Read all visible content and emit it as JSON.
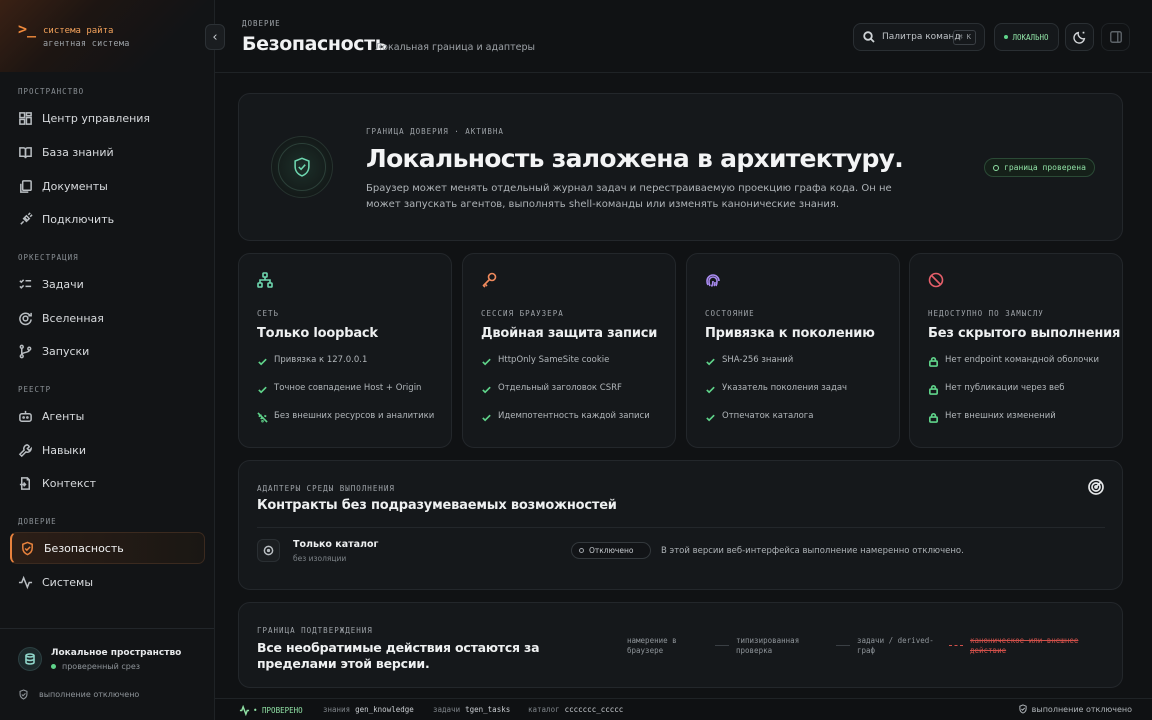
{
  "brand": {
    "prompt": ">_",
    "title": "система райта",
    "subtitle": "агентная система"
  },
  "sidebar": {
    "sections": [
      {
        "label": "ПРОСТРАНСТВО",
        "items": [
          {
            "label": "Центр управления",
            "icon": "dashboard-icon"
          },
          {
            "label": "База знаний",
            "icon": "book-icon"
          },
          {
            "label": "Документы",
            "icon": "documents-icon"
          },
          {
            "label": "Подключить",
            "icon": "plug-icon"
          }
        ]
      },
      {
        "label": "ОРКЕСТРАЦИЯ",
        "items": [
          {
            "label": "Задачи",
            "icon": "task-list-icon"
          },
          {
            "label": "Вселенная",
            "icon": "universe-icon"
          },
          {
            "label": "Запуски",
            "icon": "branch-icon"
          }
        ]
      },
      {
        "label": "РЕЕСТР",
        "items": [
          {
            "label": "Агенты",
            "icon": "bot-icon"
          },
          {
            "label": "Навыки",
            "icon": "wrench-icon"
          },
          {
            "label": "Контекст",
            "icon": "context-icon"
          }
        ]
      },
      {
        "label": "ДОВЕРИЕ",
        "items": [
          {
            "label": "Безопасность",
            "icon": "shield-icon",
            "active": true
          },
          {
            "label": "Системы",
            "icon": "activity-icon"
          }
        ]
      }
    ],
    "workspace": {
      "title": "Локальное пространство",
      "subtitle": "проверенный срез"
    },
    "footer": "выполнение отключено"
  },
  "header": {
    "breadcrumb": "ДОВЕРИЕ",
    "title": "Безопасность",
    "subtitle": "Локальная граница и адаптеры",
    "command_palette": "Палитра команд",
    "shortcut": "⌘ K",
    "local_badge": "ЛОКАЛЬНО"
  },
  "hero": {
    "eyebrow": "ГРАНИЦА ДОВЕРИЯ · АКТИВНА",
    "title": "Локальность заложена в архитектуру.",
    "description": "Браузер может менять отдельный журнал задач и перестраиваемую проекцию графа кода. Он не может запускать агентов, выполнять shell-команды или изменять канонические знания.",
    "badge": "граница проверена"
  },
  "cards": [
    {
      "eyebrow": "СЕТЬ",
      "title": "Только loopback",
      "icon": "network-icon",
      "color": "#6ed7b0",
      "items": [
        {
          "text": "Привязка к 127.0.0.1",
          "icon": "check-icon"
        },
        {
          "text": "Точное совпадение Host + Origin",
          "icon": "check-icon"
        },
        {
          "text": "Без внешних ресурсов и аналитики",
          "icon": "wifi-off-icon"
        }
      ]
    },
    {
      "eyebrow": "СЕССИЯ БРАУЗЕРА",
      "title": "Двойная защита записи",
      "icon": "key-icon",
      "color": "#f08a5d",
      "items": [
        {
          "text": "HttpOnly SameSite cookie",
          "icon": "check-icon"
        },
        {
          "text": "Отдельный заголовок CSRF",
          "icon": "check-icon"
        },
        {
          "text": "Идемпотентность каждой записи",
          "icon": "check-icon"
        }
      ]
    },
    {
      "eyebrow": "СОСТОЯНИЕ",
      "title": "Привязка к поколению",
      "icon": "fingerprint-icon",
      "color": "#a98bf0",
      "items": [
        {
          "text": "SHA-256 знаний",
          "icon": "check-icon"
        },
        {
          "text": "Указатель поколения задач",
          "icon": "check-icon"
        },
        {
          "text": "Отпечаток каталога",
          "icon": "check-icon"
        }
      ]
    },
    {
      "eyebrow": "НЕДОСТУПНО ПО ЗАМЫСЛУ",
      "title": "Без скрытого выполнения",
      "icon": "ban-icon",
      "color": "#e65f6a",
      "items": [
        {
          "text": "Нет endpoint командной оболочки",
          "icon": "lock-icon"
        },
        {
          "text": "Нет публикации через веб",
          "icon": "lock-icon"
        },
        {
          "text": "Нет внешних изменений",
          "icon": "lock-icon"
        }
      ]
    }
  ],
  "adapters": {
    "eyebrow": "АДАПТЕРЫ СРЕДЫ ВЫПОЛНЕНИЯ",
    "title": "Контракты без подразумеваемых возможностей",
    "row": {
      "title": "Только каталог",
      "subtitle": "без изоляции",
      "status": "Отключено",
      "note": "В этой версии веб-интерфейса выполнение намеренно отключено."
    }
  },
  "confirm": {
    "eyebrow": "ГРАНИЦА ПОДТВЕРЖДЕНИЯ",
    "title": "Все необратимые действия остаются за пределами этой версии.",
    "flow": [
      "намерение в браузере",
      "типизированная проверка",
      "задачи / derived-граф",
      "каноническое или внешнее действие"
    ]
  },
  "statusbar": {
    "verified": "ПРОВЕРЕНО",
    "knowledge_label": "знания",
    "knowledge_value": "gen_knowledge",
    "tasks_label": "задачи",
    "tasks_value": "tgen_tasks",
    "catalog_label": "каталог",
    "catalog_value": "ccccccc_ccccc",
    "right": "выполнение отключено"
  },
  "colors": {
    "accent": "#e8823d",
    "success": "#8fe0a4",
    "danger": "#d1504a",
    "background": "#101214"
  }
}
